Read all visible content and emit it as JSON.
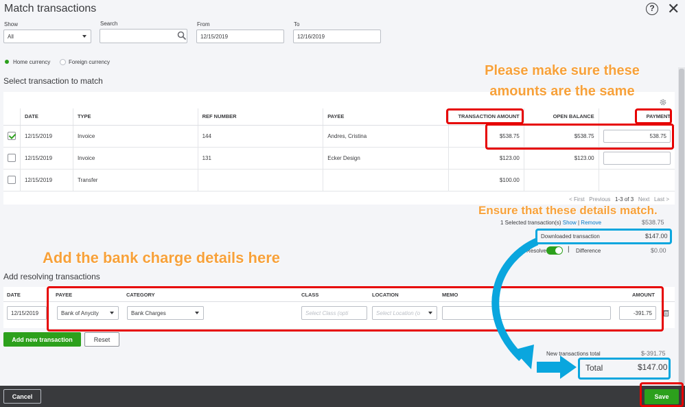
{
  "window": {
    "title": "Match transactions",
    "help_icon": "?",
    "close_icon": "✕"
  },
  "filters": {
    "show_label": "Show",
    "show_value": "All",
    "search_label": "Search",
    "search_value": "",
    "from_label": "From",
    "from_value": "12/15/2019",
    "to_label": "To",
    "to_value": "12/16/2019"
  },
  "currency": {
    "home": "Home currency",
    "foreign": "Foreign currency",
    "selected": "home"
  },
  "select_section": {
    "title": "Select transaction to match",
    "columns": [
      "DATE",
      "TYPE",
      "REF NUMBER",
      "PAYEE",
      "TRANSACTION AMOUNT",
      "OPEN BALANCE",
      "PAYMENT"
    ],
    "rows": [
      {
        "checked": true,
        "date": "12/15/2019",
        "type": "Invoice",
        "ref": "144",
        "payee": "Andres, Cristina",
        "amount": "$538.75",
        "open_balance": "$538.75",
        "payment": "538.75"
      },
      {
        "checked": false,
        "date": "12/15/2019",
        "type": "Invoice",
        "ref": "131",
        "payee": "Ecker Design",
        "amount": "$123.00",
        "open_balance": "$123.00",
        "payment": ""
      },
      {
        "checked": false,
        "date": "12/15/2019",
        "type": "Transfer",
        "ref": "",
        "payee": "",
        "amount": "$100.00",
        "open_balance": "",
        "payment": null
      }
    ],
    "pagination": {
      "first": "< First",
      "previous": "Previous",
      "range": "1-3 of 3",
      "next": "Next",
      "last": "Last >"
    }
  },
  "summary": {
    "selected_text": "1 Selected transaction(s)",
    "show_link": "Show",
    "separator": "|",
    "remove_link": "Remove",
    "selected_amount": "$538.75",
    "downloaded_label": "Downloaded transaction",
    "downloaded_amount": "$147.00",
    "resolve_label": "Resolve",
    "difference_label": "Difference",
    "difference_amount": "$0.00"
  },
  "resolve_section": {
    "title": "Add resolving transactions",
    "columns": [
      "DATE",
      "PAYEE",
      "CATEGORY",
      "CLASS",
      "LOCATION",
      "MEMO",
      "AMOUNT"
    ],
    "row": {
      "date": "12/15/2019",
      "payee": "Bank of Anycity",
      "category": "Bank Charges",
      "class_placeholder": "Select Class (opti",
      "location_placeholder": "Select Location (o",
      "memo": "",
      "amount": "-391.75"
    },
    "add_button": "Add new transaction",
    "reset_button": "Reset"
  },
  "totals": {
    "new_label": "New transactions total",
    "new_amount": "$-391.75",
    "total_label": "Total",
    "total_amount": "$147.00"
  },
  "footer": {
    "cancel": "Cancel",
    "save": "Save"
  },
  "annotations": {
    "note1_line1": "Please make sure these",
    "note1_line2": "amounts are the same",
    "note2": "Ensure that these details match.",
    "note3": "Add the bank charge details here"
  },
  "colors": {
    "accent": "#2ca01c",
    "annotation_red": "#e60000",
    "annotation_blue": "#0aa6de",
    "annotation_orange": "#f7a13a",
    "footer": "#393a3d"
  }
}
